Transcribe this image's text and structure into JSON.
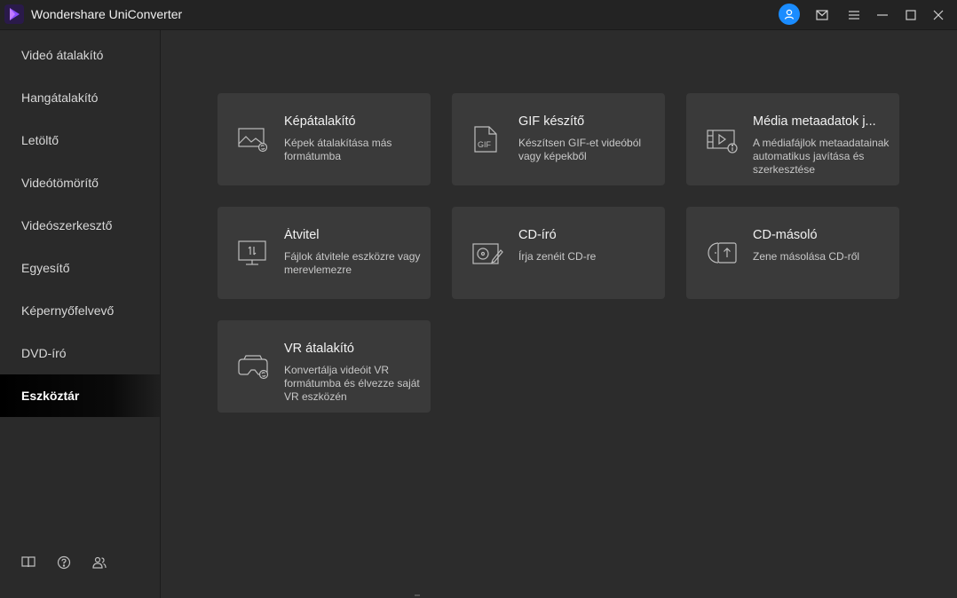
{
  "window": {
    "title": "Wondershare UniConverter",
    "accent": "#1a8cff"
  },
  "sidebar": {
    "items": [
      {
        "label": "Videó átalakító"
      },
      {
        "label": "Hangátalakító"
      },
      {
        "label": "Letöltő"
      },
      {
        "label": "Videótömörítő"
      },
      {
        "label": "Videószerkesztő"
      },
      {
        "label": "Egyesítő"
      },
      {
        "label": "Képernyőfelvevő"
      },
      {
        "label": "DVD-író"
      },
      {
        "label": "Eszköztár",
        "active": true
      }
    ],
    "bottom_icons": [
      "book-icon",
      "help-icon",
      "community-icon"
    ]
  },
  "tools": [
    {
      "title": "Képátalakító",
      "desc": "Képek átalakítása más formátumba",
      "icon": "image-convert-icon"
    },
    {
      "title": "GIF készítő",
      "desc": "Készítsen GIF-et videóból vagy képekből",
      "icon": "gif-icon"
    },
    {
      "title": "Média metaadatok j...",
      "desc": "A médiafájlok metaadatainak automatikus javítása és szerkesztése",
      "icon": "metadata-icon"
    },
    {
      "title": "Átvitel",
      "desc": "Fájlok átvitele eszközre vagy merevlemezre",
      "icon": "transfer-icon"
    },
    {
      "title": "CD-író",
      "desc": "Írja zenéit CD-re",
      "icon": "cd-burner-icon"
    },
    {
      "title": "CD-másoló",
      "desc": "Zene másolása CD-ről",
      "icon": "cd-ripper-icon"
    },
    {
      "title": "VR átalakító",
      "desc": "Konvertálja videóit VR formátumba és élvezze saját VR eszközén",
      "icon": "vr-icon"
    }
  ]
}
